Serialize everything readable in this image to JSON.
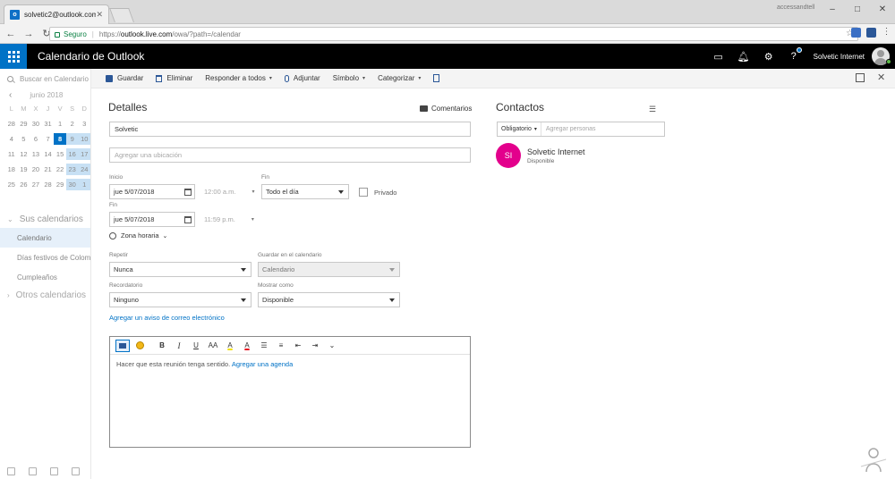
{
  "browser": {
    "tab_title": "solvetic2@outlook.com",
    "tab_favicon": "outlook-icon",
    "profile_chip": "accessandtell",
    "secure_label": "Seguro",
    "url_proto": "https://",
    "url_host": "outlook.live.com",
    "url_path": "/owa/?path=/calendar"
  },
  "app": {
    "title": "Calendario de Outlook",
    "user_name": "Solvetic Internet",
    "accent_color": "#0072c6"
  },
  "left": {
    "search_placeholder": "Buscar en Calendario",
    "month_label": "junio 2018",
    "weekday_headers": [
      "L",
      "M",
      "X",
      "J",
      "V",
      "S",
      "D"
    ],
    "weeks": [
      [
        "28",
        "29",
        "30",
        "31",
        "1",
        "2",
        "3"
      ],
      [
        "4",
        "5",
        "6",
        "7",
        "8",
        "9",
        "10"
      ],
      [
        "11",
        "12",
        "13",
        "14",
        "15",
        "16",
        "17"
      ],
      [
        "18",
        "19",
        "20",
        "21",
        "22",
        "23",
        "24"
      ],
      [
        "25",
        "26",
        "27",
        "28",
        "29",
        "30",
        "1"
      ]
    ],
    "my_calendars_title": "Sus calendarios",
    "calendar_items": [
      "Calendario",
      "Días festivos de Colombia",
      "Cumpleaños"
    ],
    "other_calendars_title": "Otros calendarios"
  },
  "commands": {
    "save": "Guardar",
    "delete": "Eliminar",
    "reply_all": "Responder a todos",
    "attach": "Adjuntar",
    "symbol": "Símbolo",
    "categorize": "Categorizar"
  },
  "details": {
    "title": "Detalles",
    "comments": "Comentarios",
    "subject_value": "Solvetic",
    "location_placeholder": "Agregar una ubicación",
    "start_label": "Inicio",
    "start_date": "jue 5/07/2018",
    "start_time": "12:00 a.m.",
    "end_label": "Fin",
    "end_date": "jue 5/07/2018",
    "end_time": "11:59 p.m.",
    "duration_label": "Fin",
    "duration_value": "Todo el día",
    "private_label": "Privado",
    "timezone": "Zona horaria",
    "repeat_label": "Repetir",
    "repeat_value": "Nunca",
    "save_in_label": "Guardar en el calendario",
    "save_in_value": "Calendario",
    "reminder_label": "Recordatorio",
    "reminder_value": "Ninguno",
    "show_as_label": "Mostrar como",
    "show_as_value": "Disponible",
    "email_reminder_link": "Agregar un aviso de correo electrónico",
    "body_text": "Hacer que esta reunión tenga sentido.",
    "agenda_link": "Agregar una agenda"
  },
  "contacts": {
    "title": "Contactos",
    "required_label": "Obligatorio",
    "add_people_placeholder": "Agregar personas",
    "attendee_initials": "SI",
    "attendee_name": "Solvetic Internet",
    "attendee_status": "Disponible",
    "attendee_color": "#e3008c"
  }
}
